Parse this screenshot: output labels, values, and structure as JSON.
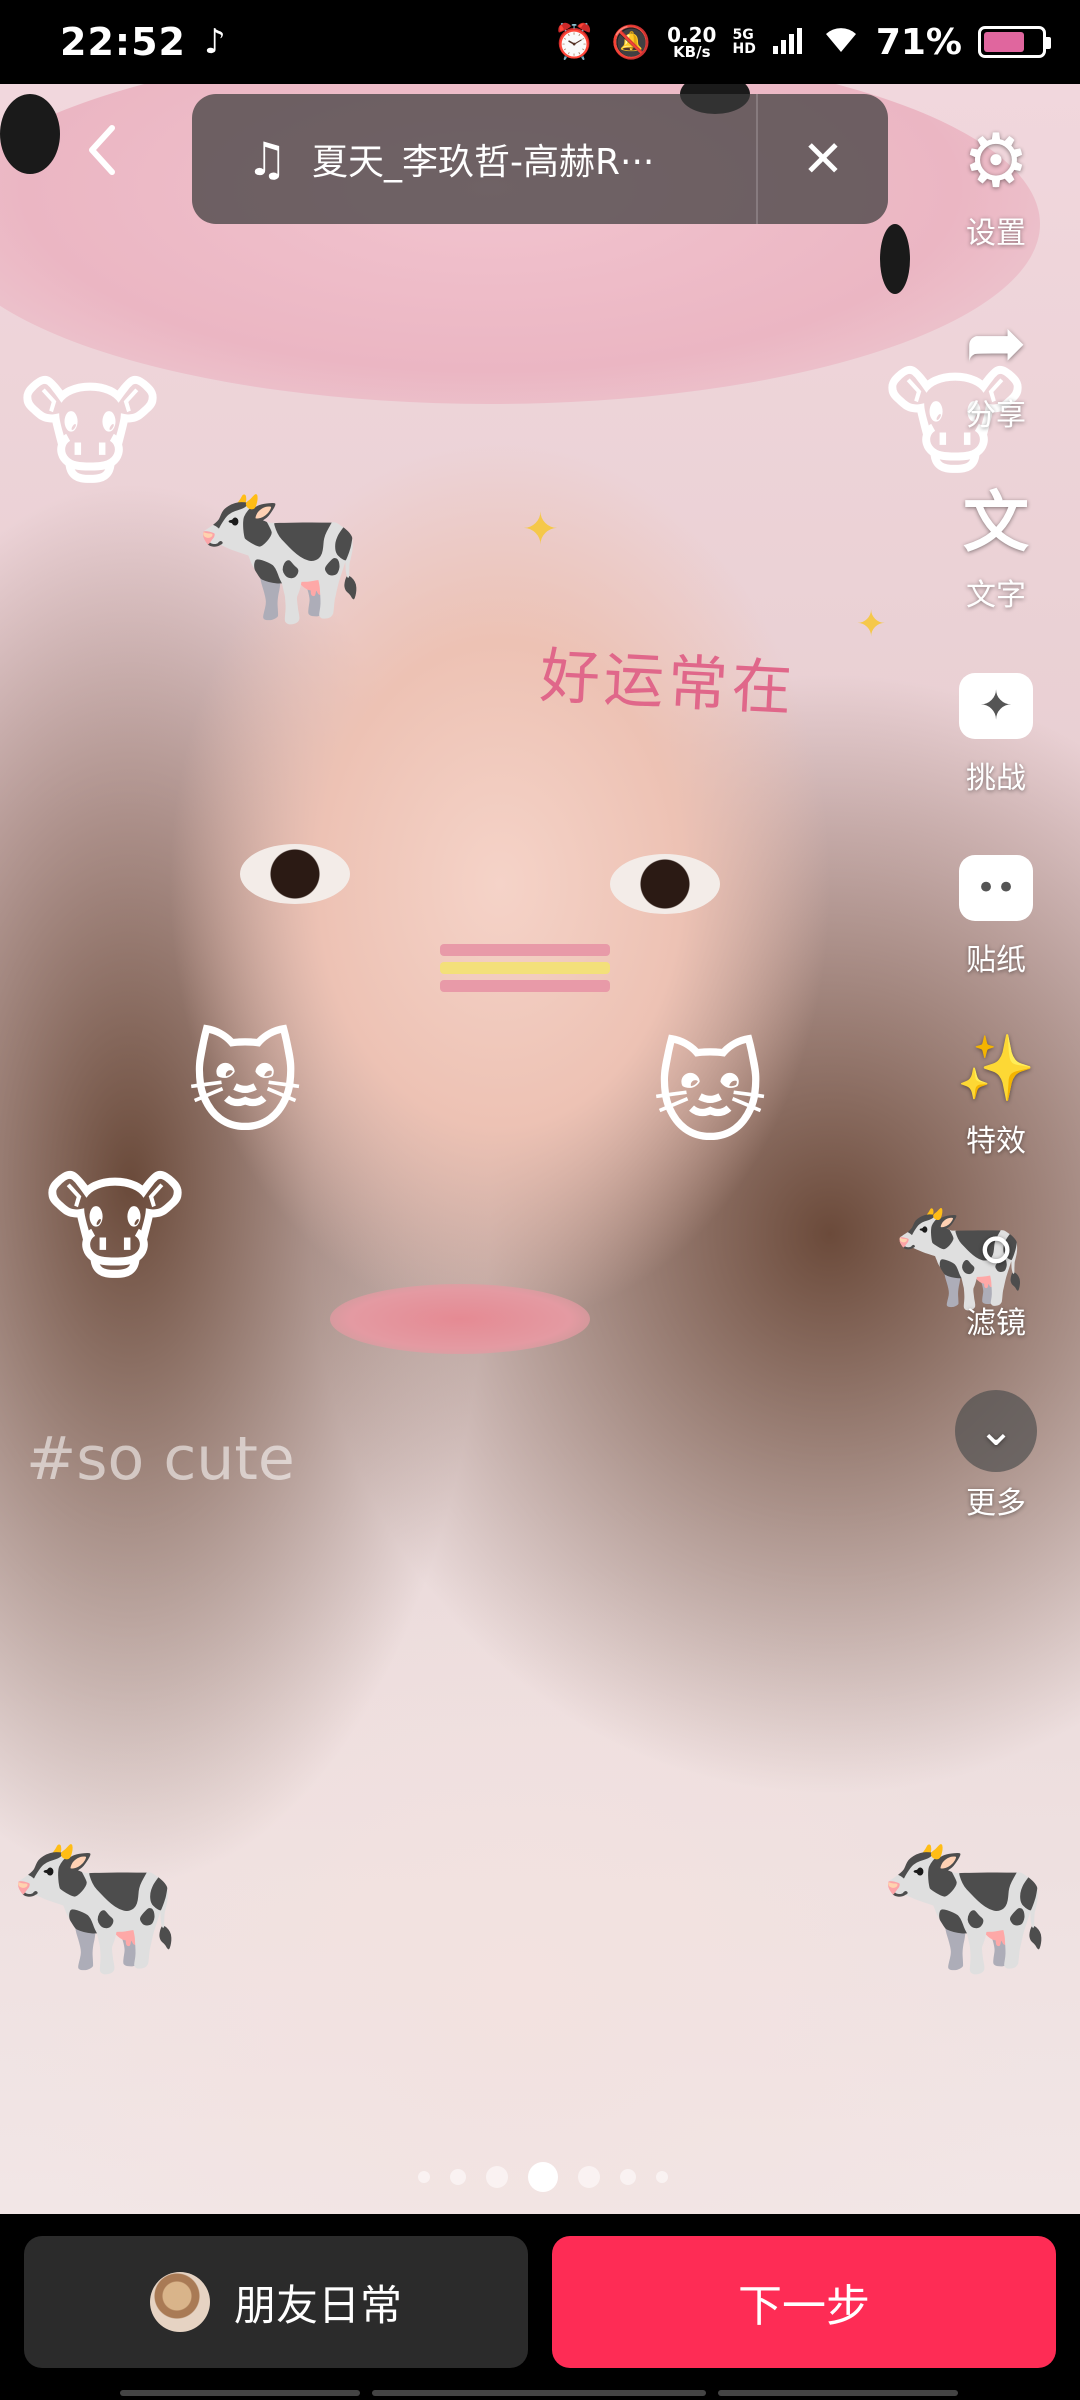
{
  "status_bar": {
    "time": "22:52",
    "app_icon": "tiktok-icon",
    "net_speed": "0.20",
    "net_unit": "KB/s",
    "network_type_top": "5G",
    "network_type_bottom": "HD",
    "battery": "71%",
    "battery_level": 0.71,
    "battery_color": "#e0669e"
  },
  "music": {
    "title": "夏天_李玖哲-高赫R···"
  },
  "toolbar": {
    "settings": "设置",
    "share": "分享",
    "text": "文字",
    "challenge": "挑战",
    "sticker": "贴纸",
    "effects": "特效",
    "filter": "滤镜",
    "more": "更多"
  },
  "overlay": {
    "deco_text": "好运常在",
    "hashtag": "#so cute"
  },
  "pagination": {
    "total": 7,
    "active_index": 3
  },
  "bottom": {
    "daily_label": "朋友日常",
    "next_label": "下一步",
    "next_color": "#fe2c55"
  }
}
